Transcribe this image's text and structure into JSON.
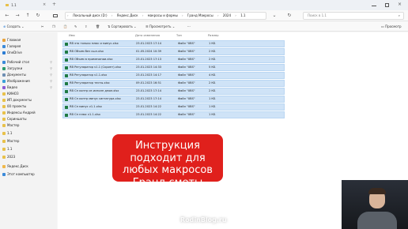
{
  "window": {
    "tab_title": "1.1",
    "close_glyph": "×"
  },
  "navigation": {
    "breadcrumbs": [
      "Локальный диск (D:)",
      "Яндекс.Диск",
      "макросы и формы",
      "Гранд Макросы",
      "2024",
      "1.1"
    ],
    "search_placeholder": "Поиск в 1.1"
  },
  "toolbar": {
    "create_label": "Создать",
    "sort_label": "Сортировать",
    "view_label": "Просмотреть",
    "preview_label": "Просмотр"
  },
  "sidebar": {
    "items": [
      {
        "label": "Главная",
        "icon": "home-icon",
        "color": "#e8a33c",
        "pinned": false
      },
      {
        "label": "Галерея",
        "icon": "gallery-icon",
        "color": "#3b8ad9",
        "pinned": false
      },
      {
        "label": "OneDrive",
        "icon": "cloud-icon",
        "color": "#2b7cd3",
        "pinned": false
      },
      {
        "label": "Рабочий стол",
        "icon": "desktop-icon",
        "color": "#3b8ad9",
        "pinned": true
      },
      {
        "label": "Загрузки",
        "icon": "download-icon",
        "color": "#2c9a6a",
        "pinned": true
      },
      {
        "label": "Документы",
        "icon": "document-icon",
        "color": "#6f8fb3",
        "pinned": true
      },
      {
        "label": "Изображения",
        "icon": "image-icon",
        "color": "#3aa0d8",
        "pinned": true
      },
      {
        "label": "Видео",
        "icon": "video-icon",
        "color": "#8a5bd6",
        "pinned": true
      },
      {
        "label": "КИНОЗ",
        "icon": "folder-icon",
        "color": "#e8c14a",
        "pinned": false
      },
      {
        "label": "ИП документы",
        "icon": "folder-icon",
        "color": "#e8c14a",
        "pinned": false
      },
      {
        "label": "00 проекты",
        "icon": "folder-icon",
        "color": "#e8c14a",
        "pinned": false
      },
      {
        "label": "Индексы Андрей",
        "icon": "folder-icon",
        "color": "#e8c14a",
        "pinned": false
      },
      {
        "label": "Скриншоты",
        "icon": "folder-icon",
        "color": "#e8c14a",
        "pinned": false
      },
      {
        "label": "Мастер",
        "icon": "folder-icon",
        "color": "#e8c14a",
        "pinned": false
      },
      {
        "label": "1.1",
        "icon": "folder-icon",
        "color": "#e8c14a",
        "pinned": false
      },
      {
        "label": "Мастер",
        "icon": "folder-icon",
        "color": "#e8c14a",
        "pinned": false
      },
      {
        "label": "1.1",
        "icon": "folder-icon",
        "color": "#e8c14a",
        "pinned": false
      },
      {
        "label": "2023",
        "icon": "folder-icon",
        "color": "#e8c14a",
        "pinned": false
      },
      {
        "label": "Яндекс.Диск",
        "icon": "yandex-disk-icon",
        "color": "#f0b84a",
        "pinned": false
      },
      {
        "label": "Этот компьютер",
        "icon": "computer-icon",
        "color": "#3b8ad9",
        "pinned": false
      }
    ]
  },
  "file_list": {
    "columns": [
      "Имя",
      "Дата изменения",
      "Тип",
      "Размер"
    ],
    "rows": [
      {
        "name": "RB это только плюс и минус.xlsx",
        "date": "23.01.2023 17:14",
        "type": "Файл \"XBS\"",
        "size": "1 КБ"
      },
      {
        "name": "RB Объем без сшл.xlsx",
        "date": "01.05.2024 10:39",
        "type": "Файл \"XBS\"",
        "size": "2 КБ"
      },
      {
        "name": "RB Объем в примечании.xlsx",
        "date": "23.01.2023 17:13",
        "type": "Файл \"XBS\"",
        "size": "2 КБ"
      },
      {
        "name": "RB Регуляратор v1.1 (Скрипт).xlsx",
        "date": "23.01.2023 14:33",
        "type": "Файл \"XBS\"",
        "size": "5 КБ"
      },
      {
        "name": "RB Регуляратор v1.1.xlsx",
        "date": "23.01.2023 14:17",
        "type": "Файл \"XBS\"",
        "size": "4 КБ"
      },
      {
        "name": "RB Регуляратор тесты.xlsx",
        "date": "09.01.2023 16:51",
        "type": "Файл \"XBS\"",
        "size": "2 КБ"
      },
      {
        "name": "RB Сн контр из исполн дном.xlsx",
        "date": "23.01.2023 17:14",
        "type": "Файл \"XBS\"",
        "size": "2 КБ"
      },
      {
        "name": "RB Сн контр минус сигнатура.xlsx",
        "date": "23.01.2023 17:14",
        "type": "Файл \"XBS\"",
        "size": "1 КБ"
      },
      {
        "name": "RB Сн минус v1.1.xlsx",
        "date": "23.01.2023 14:22",
        "type": "Файл \"XBS\"",
        "size": "1 КБ"
      },
      {
        "name": "RB Сн плюс v1.1.xlsx",
        "date": "23.01.2023 14:22",
        "type": "Файл \"XBS\"",
        "size": "1 КБ"
      }
    ]
  },
  "overlay": {
    "banner_text": "Инструкция подходит для любых макросов Гранд сметы",
    "banner_color": "#e0201c",
    "watermark": "RodinBlog.ru"
  }
}
